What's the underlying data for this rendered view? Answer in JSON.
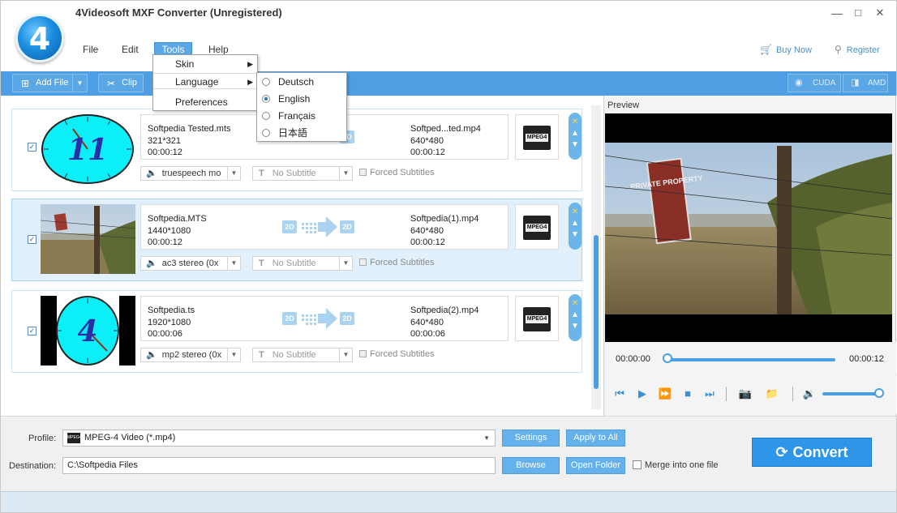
{
  "window": {
    "title": "4Videosoft MXF Converter (Unregistered)",
    "logo_text": "4",
    "controls": {
      "minimize": "—",
      "maximize": "□",
      "close": "✕"
    }
  },
  "menu": {
    "file": "File",
    "edit": "Edit",
    "tools": "Tools",
    "help": "Help"
  },
  "header_links": {
    "buy_now": "Buy Now",
    "register": "Register"
  },
  "toolbar": {
    "add_file": "Add File",
    "clip": "Clip",
    "cuda": "CUDA",
    "amd": "AMD"
  },
  "tools_menu": {
    "items": [
      {
        "label": "Skin",
        "has_submenu": true
      },
      {
        "label": "Language",
        "has_submenu": true
      },
      {
        "label": "Preferences",
        "has_submenu": false
      }
    ]
  },
  "language_menu": {
    "selected": "English",
    "items": [
      {
        "label": "Deutsch",
        "checked": false
      },
      {
        "label": "English",
        "checked": true
      },
      {
        "label": "Français",
        "checked": false
      },
      {
        "label": "日本語",
        "checked": false
      }
    ]
  },
  "files": [
    {
      "checked": true,
      "source_name": "Softpedia Tested.mts",
      "source_res": "321*321",
      "source_duration": "00:00:12",
      "output_name": "Softped...ted.mp4",
      "output_res": "640*480",
      "output_duration": "00:00:12",
      "audio": "truespeech mo",
      "subtitle": "No Subtitle",
      "forced_subtitles": "Forced Subtitles",
      "badge_left": "2D",
      "badge_right": "2D",
      "format_label": "MPEG4",
      "thumb_number": "11"
    },
    {
      "checked": true,
      "source_name": "Softpedia.MTS",
      "source_res": "1440*1080",
      "source_duration": "00:00:12",
      "output_name": "Softpedia(1).mp4",
      "output_res": "640*480",
      "output_duration": "00:00:12",
      "audio": "ac3 stereo (0x",
      "subtitle": "No Subtitle",
      "forced_subtitles": "Forced Subtitles",
      "badge_left": "2D",
      "badge_right": "2D",
      "format_label": "MPEG4"
    },
    {
      "checked": true,
      "source_name": "Softpedia.ts",
      "source_res": "1920*1080",
      "source_duration": "00:00:06",
      "output_name": "Softpedia(2).mp4",
      "output_res": "640*480",
      "output_duration": "00:00:06",
      "audio": "mp2 stereo (0x",
      "subtitle": "No Subtitle",
      "forced_subtitles": "Forced Subtitles",
      "badge_left": "2D",
      "badge_right": "2D",
      "format_label": "MPEG4",
      "thumb_number": "4"
    }
  ],
  "preview": {
    "label": "Preview",
    "time_current": "00:00:00",
    "time_total": "00:00:12",
    "sign_text": "PRIVATE PROPERTY",
    "progress": 0,
    "volume": 1
  },
  "bottom": {
    "profile_label": "Profile:",
    "profile_value": "MPEG-4 Video (*.mp4)",
    "profile_icon_text": "MPEG4",
    "settings": "Settings",
    "apply_to_all": "Apply to All",
    "destination_label": "Destination:",
    "destination_value": "C:\\Softpedia Files",
    "browse": "Browse",
    "open_folder": "Open Folder",
    "merge_label": "Merge into one file",
    "convert": "Convert"
  },
  "colors": {
    "accent": "#4e9ee3",
    "convert_bg": "#2e96e8",
    "selected_row": "#e1f0fb"
  }
}
